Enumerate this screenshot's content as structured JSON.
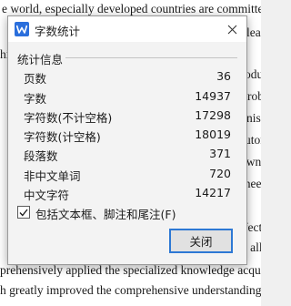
{
  "document": {
    "lines": [
      "e world, especially developed countries are committed to",
      "leart",
      "hic",
      "oduc",
      "rob",
      "nis",
      "",
      "utor",
      "own",
      "ihee",
      "",
      "fect",
      "d all",
      "prehensively applied the specialized knowledge acquir",
      "h greatly improved the comprehensive understanding ability"
    ]
  },
  "dialog": {
    "title": "字数统计",
    "section_label": "统计信息",
    "stats": [
      {
        "label": "页数",
        "value": "36"
      },
      {
        "label": "字数",
        "value": "14937"
      },
      {
        "label": "字符数(不计空格)",
        "value": "17298"
      },
      {
        "label": "字符数(计空格)",
        "value": "18019"
      },
      {
        "label": "段落数",
        "value": "371"
      },
      {
        "label": "非中文单词",
        "value": "720"
      },
      {
        "label": "中文字符",
        "value": "14217"
      }
    ],
    "checkbox": {
      "label": "包括文本框、脚注和尾注(F)",
      "checked": true
    },
    "close_button_label": "关闭",
    "accent_color": "#2b6fdc"
  }
}
